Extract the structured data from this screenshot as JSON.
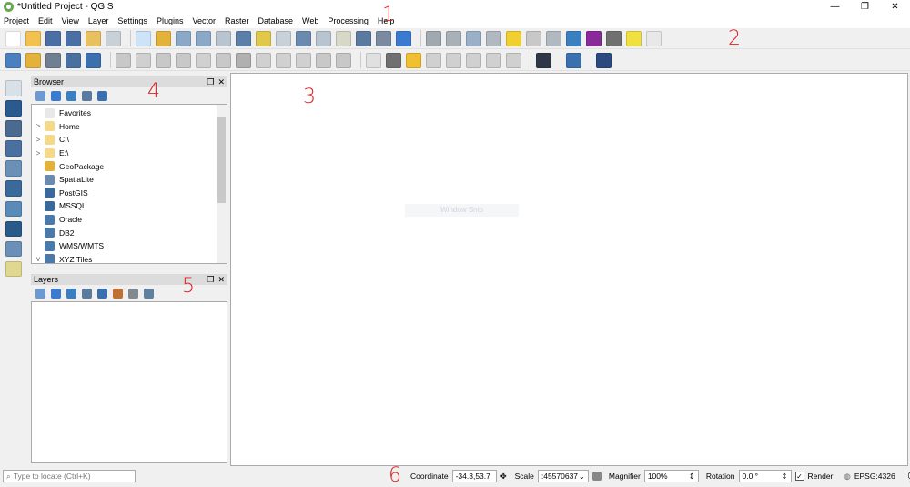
{
  "window": {
    "title": "*Untitled Project - QGIS",
    "minimize": "—",
    "restore": "❐",
    "close": "✕"
  },
  "menu": [
    "Project",
    "Edit",
    "View",
    "Layer",
    "Settings",
    "Plugins",
    "Vector",
    "Raster",
    "Database",
    "Web",
    "Processing",
    "Help"
  ],
  "toolbar1": [
    {
      "n": "new-project-icon",
      "c": "#ffffff"
    },
    {
      "n": "open-project-icon",
      "c": "#f2c14e"
    },
    {
      "n": "save-project-icon",
      "c": "#4a6fa5"
    },
    {
      "n": "save-as-icon",
      "c": "#4a6fa5"
    },
    {
      "n": "new-print-layout-icon",
      "c": "#e8c060"
    },
    {
      "n": "layout-manager-icon",
      "c": "#c8d0d8"
    },
    {
      "sep": true
    },
    {
      "n": "pan-icon",
      "c": "#cde3f7"
    },
    {
      "n": "pan-to-selection-icon",
      "c": "#e2b23a"
    },
    {
      "n": "zoom-in-icon",
      "c": "#8aa8c8"
    },
    {
      "n": "zoom-out-icon",
      "c": "#8aa8c8"
    },
    {
      "n": "zoom-native-icon",
      "c": "#b8c4d0"
    },
    {
      "n": "zoom-full-icon",
      "c": "#5a7fa8"
    },
    {
      "n": "zoom-selection-icon",
      "c": "#e2c84a"
    },
    {
      "n": "zoom-layer-icon",
      "c": "#c8d0d8"
    },
    {
      "n": "zoom-last-icon",
      "c": "#6a8ab0"
    },
    {
      "n": "zoom-next-icon",
      "c": "#b8c4d0"
    },
    {
      "n": "new-map-view-icon",
      "c": "#d8d8c8"
    },
    {
      "n": "new-bookmark-icon",
      "c": "#5a7aa0"
    },
    {
      "n": "show-bookmarks-icon",
      "c": "#7a8aa0"
    },
    {
      "n": "refresh-icon",
      "c": "#3a7ad0"
    },
    {
      "sep": true
    },
    {
      "n": "identify-icon",
      "c": "#a0a8b0"
    },
    {
      "n": "run-action-icon",
      "c": "#a8b0b8"
    },
    {
      "n": "select-features-icon",
      "c": "#9ab0c8"
    },
    {
      "n": "deselect-icon",
      "c": "#b0b8c0"
    },
    {
      "n": "deselect-all-icon",
      "c": "#f0d030"
    },
    {
      "n": "attribute-table-icon",
      "c": "#c8c8c8"
    },
    {
      "n": "field-calculator-icon",
      "c": "#b0b8c0"
    },
    {
      "n": "toolbox-icon",
      "c": "#3a80c0"
    },
    {
      "n": "statistics-icon",
      "c": "#8a2a9a"
    },
    {
      "n": "measure-icon",
      "c": "#707070"
    },
    {
      "n": "map-tips-icon",
      "c": "#f0e040"
    },
    {
      "n": "text-annotation-icon",
      "c": "#e8e8e8"
    }
  ],
  "toolbar2": [
    {
      "n": "data-source-manager-icon",
      "c": "#4a80c0"
    },
    {
      "n": "new-geopackage-icon",
      "c": "#e2b23a"
    },
    {
      "n": "new-shapefile-icon",
      "c": "#708090"
    },
    {
      "n": "new-spatialite-icon",
      "c": "#4a70a0"
    },
    {
      "n": "new-temp-layer-icon",
      "c": "#3a70b0"
    },
    {
      "sep": true
    },
    {
      "n": "current-edits-icon",
      "c": "#c8c8c8"
    },
    {
      "n": "toggle-editing-icon",
      "c": "#d0d0d0"
    },
    {
      "n": "save-edits-icon",
      "c": "#c8c8c8"
    },
    {
      "n": "add-feature-icon",
      "c": "#c8c8c8"
    },
    {
      "n": "vertex-tool-icon",
      "c": "#d0d0d0"
    },
    {
      "n": "modify-attributes-icon",
      "c": "#c8c8c8"
    },
    {
      "n": "delete-selected-icon",
      "c": "#b0b0b0"
    },
    {
      "n": "cut-features-icon",
      "c": "#d0d0d0"
    },
    {
      "n": "copy-features-icon",
      "c": "#d0d0d0"
    },
    {
      "n": "paste-features-icon",
      "c": "#d0d0d0"
    },
    {
      "n": "undo-icon",
      "c": "#c8c8c8"
    },
    {
      "n": "redo-icon",
      "c": "#c8c8c8"
    },
    {
      "sep": true
    },
    {
      "n": "label-toolbar-icon",
      "c": "#e0e0e0"
    },
    {
      "n": "diagram-icon",
      "c": "#707070"
    },
    {
      "n": "pin-labels-icon",
      "c": "#f0c030"
    },
    {
      "n": "highlight-labels-icon",
      "c": "#d0d0d0"
    },
    {
      "n": "show-hide-labels-icon",
      "c": "#d0d0d0"
    },
    {
      "n": "move-label-icon",
      "c": "#d0d0d0"
    },
    {
      "n": "rotate-label-icon",
      "c": "#d0d0d0"
    },
    {
      "n": "change-label-icon",
      "c": "#d0d0d0"
    },
    {
      "sep": true
    },
    {
      "n": "plugin-icon",
      "c": "#303848"
    },
    {
      "sep": true
    },
    {
      "n": "python-console-icon",
      "c": "#3a70b0"
    },
    {
      "sep": true
    },
    {
      "n": "help-icon",
      "c": "#2a4a80"
    }
  ],
  "leftbar": [
    {
      "n": "add-vector-layer-icon",
      "c": "#d8e0e8"
    },
    {
      "n": "add-raster-layer-icon",
      "c": "#2a5a90"
    },
    {
      "n": "add-delimited-text-icon",
      "c": "#4a6a90"
    },
    {
      "n": "add-spatialite-icon",
      "c": "#4a70a0"
    },
    {
      "n": "add-virtual-layer-icon",
      "c": "#6a90b8"
    },
    {
      "n": "add-postgis-icon",
      "c": "#3a6a9a"
    },
    {
      "n": "add-wms-icon",
      "c": "#5a8ab8"
    },
    {
      "n": "add-wfs-icon",
      "c": "#2a5a8a"
    },
    {
      "n": "add-wcs-icon",
      "c": "#6a90b8"
    },
    {
      "n": "new-shapefile-layer-icon",
      "c": "#e0d890"
    }
  ],
  "browser": {
    "title": "Browser",
    "tools": [
      "add-selected-layers-icon",
      "refresh-icon",
      "filter-icon",
      "collapse-all-icon",
      "info-icon"
    ],
    "items": [
      {
        "label": "Favorites",
        "arrow": "",
        "icon": "star-icon",
        "c": "#e8e8e8"
      },
      {
        "label": "Home",
        "arrow": ">",
        "icon": "folder-icon",
        "c": "#f5d98a"
      },
      {
        "label": "C:\\",
        "arrow": ">",
        "icon": "folder-icon",
        "c": "#f5d98a"
      },
      {
        "label": "E:\\",
        "arrow": ">",
        "icon": "folder-icon",
        "c": "#f5d98a"
      },
      {
        "label": "GeoPackage",
        "arrow": "",
        "icon": "geopackage-icon",
        "c": "#e2b23a"
      },
      {
        "label": "SpatiaLite",
        "arrow": "",
        "icon": "spatialite-icon",
        "c": "#6a8ab0"
      },
      {
        "label": "PostGIS",
        "arrow": "",
        "icon": "postgis-icon",
        "c": "#3a6a9a"
      },
      {
        "label": "MSSQL",
        "arrow": "",
        "icon": "mssql-icon",
        "c": "#3a6a9a"
      },
      {
        "label": "Oracle",
        "arrow": "",
        "icon": "oracle-icon",
        "c": "#4a7aaa"
      },
      {
        "label": "DB2",
        "arrow": "",
        "icon": "db2-icon",
        "c": "#4a7aaa"
      },
      {
        "label": "WMS/WMTS",
        "arrow": "",
        "icon": "wms-icon",
        "c": "#4a7aaa"
      },
      {
        "label": "XYZ Tiles",
        "arrow": "v",
        "icon": "xyz-tiles-icon",
        "c": "#4a7aaa"
      }
    ]
  },
  "layers": {
    "title": "Layers",
    "tools": [
      "style-panel-icon",
      "add-group-icon",
      "visibility-icon",
      "filter-legend-icon",
      "filter-expression-icon",
      "expand-all-icon",
      "collapse-all-icon",
      "remove-layer-icon"
    ]
  },
  "canvas": {
    "watermark": "Window Snip"
  },
  "annotations": [
    "1",
    "2",
    "3",
    "4",
    "5",
    "6"
  ],
  "status": {
    "locate_placeholder": "Type to locate (Ctrl+K)",
    "coordinate_label": "Coordinate",
    "coordinate": "-34.3,53.7",
    "scale_label": "Scale",
    "scale": ":45570637",
    "magnifier_label": "Magnifier",
    "magnifier": "100%",
    "rotation_label": "Rotation",
    "rotation": "0.0 °",
    "render_label": "Render",
    "crs": "EPSG:4326"
  }
}
